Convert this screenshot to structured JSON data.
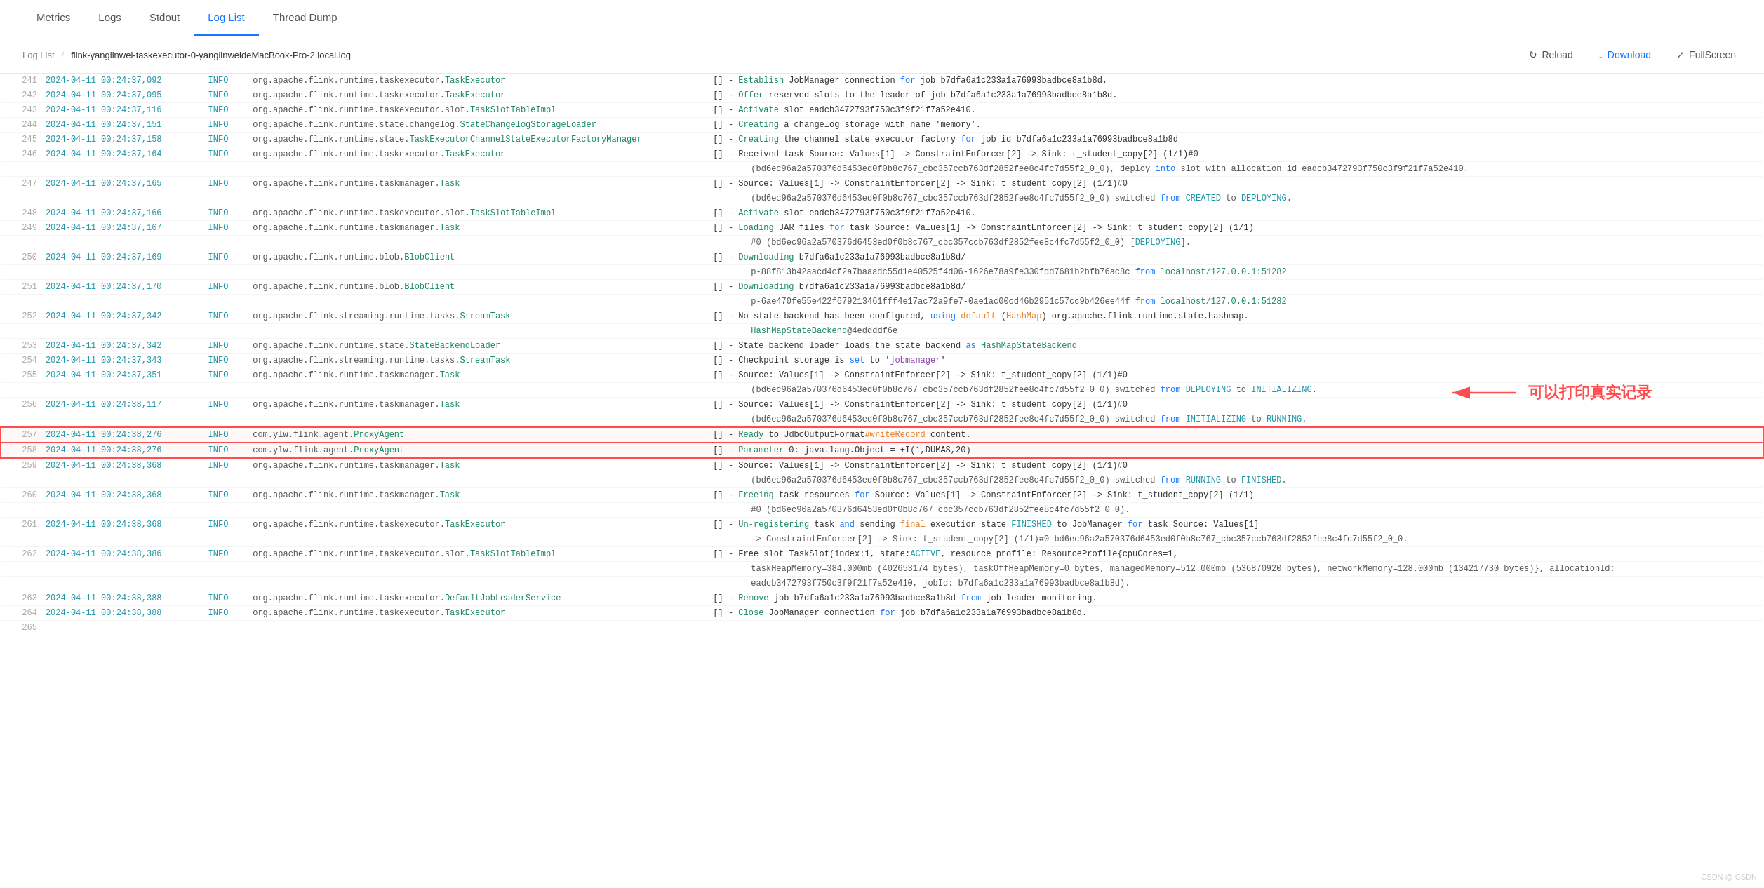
{
  "nav": {
    "items": [
      {
        "label": "Metrics",
        "active": false
      },
      {
        "label": "Logs",
        "active": false
      },
      {
        "label": "Stdout",
        "active": false
      },
      {
        "label": "Log List",
        "active": true
      },
      {
        "label": "Thread Dump",
        "active": false
      }
    ]
  },
  "toolbar": {
    "breadcrumb_home": "Log List",
    "separator": "/",
    "filename": "flink-yanglinwei-taskexecutor-0-yanglinweideMacBook-Pro-2.local.log",
    "reload_label": "Reload",
    "download_label": "Download",
    "fullscreen_label": "FullScreen"
  },
  "log_lines": [
    {
      "num": "241",
      "timestamp": "2024-04-11 00:24:37,092",
      "level": "INFO",
      "class_plain": "org.apache.flink.runtime.taskexecutor.",
      "class_link": "TaskExecutor",
      "message": "[] - Establish JobManager connection for job b7dfa6a1c233a1a76993badbce8a1b8d."
    },
    {
      "num": "242",
      "timestamp": "2024-04-11 00:24:37,095",
      "level": "INFO",
      "class_plain": "org.apache.flink.runtime.taskexecutor.",
      "class_link": "TaskExecutor",
      "message": "[] - Offer reserved slots to the leader of job b7dfa6a1c233a1a76993badbce8a1b8d."
    },
    {
      "num": "243",
      "timestamp": "2024-04-11 00:24:37,116",
      "level": "INFO",
      "class_plain": "org.apache.flink.runtime.taskexecutor.slot.",
      "class_link": "TaskSlotTableImpl",
      "message": "[] - Activate slot eadcb3472793f750c3f9f21f7a52e410."
    },
    {
      "num": "244",
      "timestamp": "2024-04-11 00:24:37,151",
      "level": "INFO",
      "class_plain": "org.apache.flink.runtime.state.changelog.",
      "class_link": "StateChangelogStorageLoader",
      "message": "[] - Creating a changelog storage with name 'memory'."
    },
    {
      "num": "245",
      "timestamp": "2024-04-11 00:24:37,158",
      "level": "INFO",
      "class_plain": "org.apache.flink.runtime.state.",
      "class_link": "TaskExecutorChannelStateExecutorFactoryManager",
      "message": "[] - Creating the channel state executor factory for job id b7dfa6a1c233a1a76993badbce8a1b8d"
    },
    {
      "num": "246",
      "timestamp": "2024-04-11 00:24:37,164",
      "level": "INFO",
      "class_plain": "org.apache.flink.runtime.taskexecutor.",
      "class_link": "TaskExecutor",
      "message": "[] - Received task Source: Values[1] -> ConstraintEnforcer[2] -> Sink: t_student_copy[2] (1/1)#0",
      "continuation": "(bd6ec96a2a570376d6453ed0f0b8c767_cbc357ccb763df2852fee8c4fc7d55f2_0_0), deploy into slot with allocation id eadcb3472793f750c3f9f21f7a52e410."
    },
    {
      "num": "247",
      "timestamp": "2024-04-11 00:24:37,165",
      "level": "INFO",
      "class_plain": "org.apache.flink.runtime.taskmanager.",
      "class_link": "Task",
      "message": "[] - Source: Values[1] -> ConstraintEnforcer[2] -> Sink: t_student_copy[2] (1/1)#0",
      "continuation": "(bd6ec96a2a570376d6453ed0f0b8c767_cbc357ccb763df2852fee8c4fc7d55f2_0_0) switched from CREATED to DEPLOYING."
    },
    {
      "num": "248",
      "timestamp": "2024-04-11 00:24:37,166",
      "level": "INFO",
      "class_plain": "org.apache.flink.runtime.taskexecutor.slot.",
      "class_link": "TaskSlotTableImpl",
      "message": "[] - Activate slot eadcb3472793f750c3f9f21f7a52e410."
    },
    {
      "num": "249",
      "timestamp": "2024-04-11 00:24:37,167",
      "level": "INFO",
      "class_plain": "org.apache.flink.runtime.taskmanager.",
      "class_link": "Task",
      "message": "[] - Loading JAR files for task Source: Values[1] -> ConstraintEnforcer[2] -> Sink: t_student_copy[2] (1/1)",
      "continuation": "#0 (bd6ec96a2a570376d6453ed0f0b8c767_cbc357ccb763df2852fee8c4fc7d55f2_0_0) [DEPLOYING]."
    },
    {
      "num": "250",
      "timestamp": "2024-04-11 00:24:37,169",
      "level": "INFO",
      "class_plain": "org.apache.flink.runtime.blob.",
      "class_link": "BlobClient",
      "message": "[] - Downloading b7dfa6a1c233a1a76993badbce8a1b8d/",
      "continuation": "p-88f813b42aacd4cf2a7baaadc55d1e40525f4d06-1626e78a9fe330fdd7681b2bfb76ac8c from localhost/127.0.0.1:51282"
    },
    {
      "num": "251",
      "timestamp": "2024-04-11 00:24:37,170",
      "level": "INFO",
      "class_plain": "org.apache.flink.runtime.blob.",
      "class_link": "BlobClient",
      "message": "[] - Downloading b7dfa6a1c233a1a76993badbce8a1b8d/",
      "continuation": "p-6ae470fe55e422f679213461fff4e17ac72a9fe7-0ae1ac00cd46b2951c57cc9b426ee44f from localhost/127.0.0.1:51282"
    },
    {
      "num": "252",
      "timestamp": "2024-04-11 00:24:37,342",
      "level": "INFO",
      "class_plain": "org.apache.flink.streaming.runtime.tasks.",
      "class_link": "StreamTask",
      "message": "[] - No state backend has been configured, using default (HashMap) org.apache.flink.runtime.state.hashmap.",
      "continuation": "HashMapStateBackend@4eddddf6e"
    },
    {
      "num": "253",
      "timestamp": "2024-04-11 00:24:37,342",
      "level": "INFO",
      "class_plain": "org.apache.flink.runtime.state.",
      "class_link": "StateBackendLoader",
      "message": "[] - State backend loader loads the state backend as HashMapStateBackend"
    },
    {
      "num": "254",
      "timestamp": "2024-04-11 00:24:37,343",
      "level": "INFO",
      "class_plain": "org.apache.flink.streaming.runtime.tasks.",
      "class_link": "StreamTask",
      "message": "[] - Checkpoint storage is set to 'jobmanager'"
    },
    {
      "num": "255",
      "timestamp": "2024-04-11 00:24:37,351",
      "level": "INFO",
      "class_plain": "org.apache.flink.runtime.taskmanager.",
      "class_link": "Task",
      "message": "[] - Source: Values[1] -> ConstraintEnforcer[2] -> Sink: t_student_copy[2] (1/1)#0",
      "continuation": "(bd6ec96a2a570376d6453ed0f0b8c767_cbc357ccb763df2852fee8c4fc7d55f2_0_0) switched from DEPLOYING to INITIALIZING."
    },
    {
      "num": "256",
      "timestamp": "2024-04-11 00:24:38,117",
      "level": "INFO",
      "class_plain": "org.apache.flink.runtime.taskmanager.",
      "class_link": "Task",
      "message": "[] - Source: Values[1] -> ConstraintEnforcer[2] -> Sink: t_student_copy[2] (1/1)#0",
      "continuation": "(bd6ec96a2a570376d6453ed0f0b8c767_cbc357ccb763df2852fee8c4fc7d55f2_0_0) switched from INITIALIZING to RUNNING."
    },
    {
      "num": "257",
      "timestamp": "2024-04-11 00:24:38,276",
      "level": "INFO",
      "class_plain": "com.ylw.flink.agent.",
      "class_link": "ProxyAgent",
      "message": "[] - Ready to JdbcOutputFormat#writeRecord content.",
      "highlighted": true
    },
    {
      "num": "258",
      "timestamp": "2024-04-11 00:24:38,276",
      "level": "INFO",
      "class_plain": "com.ylw.flink.agent.",
      "class_link": "ProxyAgent",
      "message": "[] - Parameter 0: java.lang.Object = +I(1,DUMAS,20)",
      "highlighted": true
    },
    {
      "num": "259",
      "timestamp": "2024-04-11 00:24:38,368",
      "level": "INFO",
      "class_plain": "org.apache.flink.runtime.taskmanager.",
      "class_link": "Task",
      "message": "[] - Source: Values[1] -> ConstraintEnforcer[2] -> Sink: t_student_copy[2] (1/1)#0",
      "continuation": "(bd6ec96a2a570376d6453ed0f0b8c767_cbc357ccb763df2852fee8c4fc7d55f2_0_0) switched from RUNNING to FINISHED."
    },
    {
      "num": "260",
      "timestamp": "2024-04-11 00:24:38,368",
      "level": "INFO",
      "class_plain": "org.apache.flink.runtime.taskmanager.",
      "class_link": "Task",
      "message": "[] - Freeing task resources for Source: Values[1] -> ConstraintEnforcer[2] -> Sink: t_student_copy[2] (1/1)",
      "continuation": "#0 (bd6ec96a2a570376d6453ed0f0b8c767_cbc357ccb763df2852fee8c4fc7d55f2_0_0)."
    },
    {
      "num": "261",
      "timestamp": "2024-04-11 00:24:38,368",
      "level": "INFO",
      "class_plain": "org.apache.flink.runtime.taskexecutor.",
      "class_link": "TaskExecutor",
      "message": "[] - Un-registering task and sending final execution state FINISHED to JobManager for task Source: Values[1]",
      "continuation": "-> ConstraintEnforcer[2] -> Sink: t_student_copy[2] (1/1)#0 bd6ec96a2a570376d6453ed0f0b8c767_cbc357ccb763df2852fee8c4fc7d55f2_0_0."
    },
    {
      "num": "262",
      "timestamp": "2024-04-11 00:24:38,386",
      "level": "INFO",
      "class_plain": "org.apache.flink.runtime.taskexecutor.slot.",
      "class_link": "TaskSlotTableImpl",
      "message": "[] - Free slot TaskSlot(index:1, state:ACTIVE, resource profile: ResourceProfile{cpuCores=1,",
      "continuation": "taskHeapMemory=384.000mb (402653174 bytes), taskOffHeapMemory=0 bytes, managedMemory=512.000mb (536870920 bytes), networkMemory=128.000mb (134217730 bytes)}, allocationId:",
      "continuation2": "eadcb3472793f750c3f9f21f7a52e410, jobId: b7dfa6a1c233a1a76993badbce8a1b8d)."
    },
    {
      "num": "263",
      "timestamp": "2024-04-11 00:24:38,388",
      "level": "INFO",
      "class_plain": "org.apache.flink.runtime.taskexecutor.",
      "class_link": "DefaultJobLeaderService",
      "message": "[] - Remove job b7dfa6a1c233a1a76993badbce8a1b8d from job leader monitoring."
    },
    {
      "num": "264",
      "timestamp": "2024-04-11 00:24:38,388",
      "level": "INFO",
      "class_plain": "org.apache.flink.runtime.taskexecutor.",
      "class_link": "TaskExecutor",
      "message": "[] - Close JobManager connection for job b7dfa6a1c233a1a76993badbce8a1b8d."
    },
    {
      "num": "265",
      "timestamp": "",
      "level": "",
      "class_plain": "",
      "class_link": "",
      "message": ""
    }
  ],
  "annotation": {
    "text": "可以打印真实记录",
    "arrow": "→"
  },
  "watermark": "CSDN @ CSDN"
}
